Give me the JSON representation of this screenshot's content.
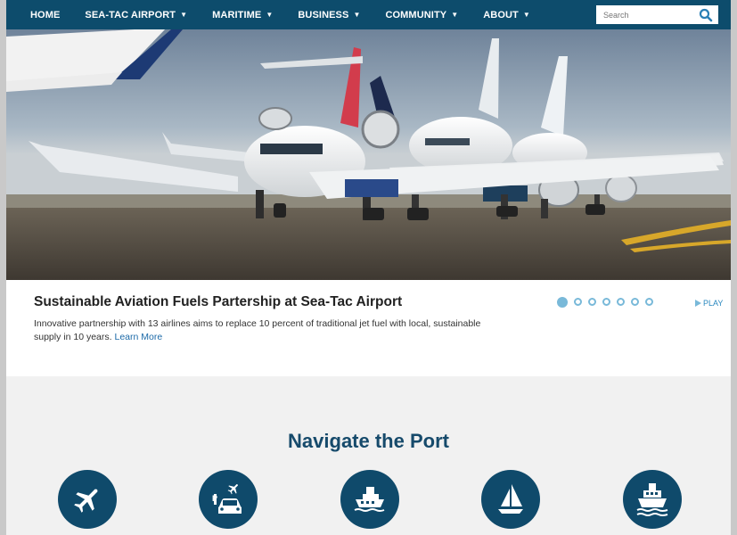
{
  "nav": {
    "items": [
      {
        "label": "HOME",
        "dropdown": false
      },
      {
        "label": "SEA-TAC AIRPORT",
        "dropdown": true
      },
      {
        "label": "MARITIME",
        "dropdown": true
      },
      {
        "label": "BUSINESS",
        "dropdown": true
      },
      {
        "label": "COMMUNITY",
        "dropdown": true
      },
      {
        "label": "ABOUT",
        "dropdown": true
      }
    ],
    "search_placeholder": "Search",
    "search_icon": "search-icon"
  },
  "hero": {
    "image": "airplanes-on-runway"
  },
  "caption": {
    "title": "Sustainable Aviation Fuels Partership at Sea-Tac Airport",
    "description": "Innovative partnership with 13 airlines aims to replace 10 percent of traditional jet fuel with local, sustainable supply in 10 years.",
    "link": "Learn More"
  },
  "carousel": {
    "slide_count": 7,
    "active_index": 0,
    "play_label": "PLAY"
  },
  "navigate": {
    "title": "Navigate the Port",
    "icons": [
      "airplane-icon",
      "parking-car-icon",
      "ferry-icon",
      "sailboat-icon",
      "cruise-ship-icon"
    ]
  },
  "colors": {
    "nav_bg": "#0d4c6c",
    "accent": "#79b9d9",
    "link": "#1c6aa8",
    "heading": "#164a6b"
  }
}
